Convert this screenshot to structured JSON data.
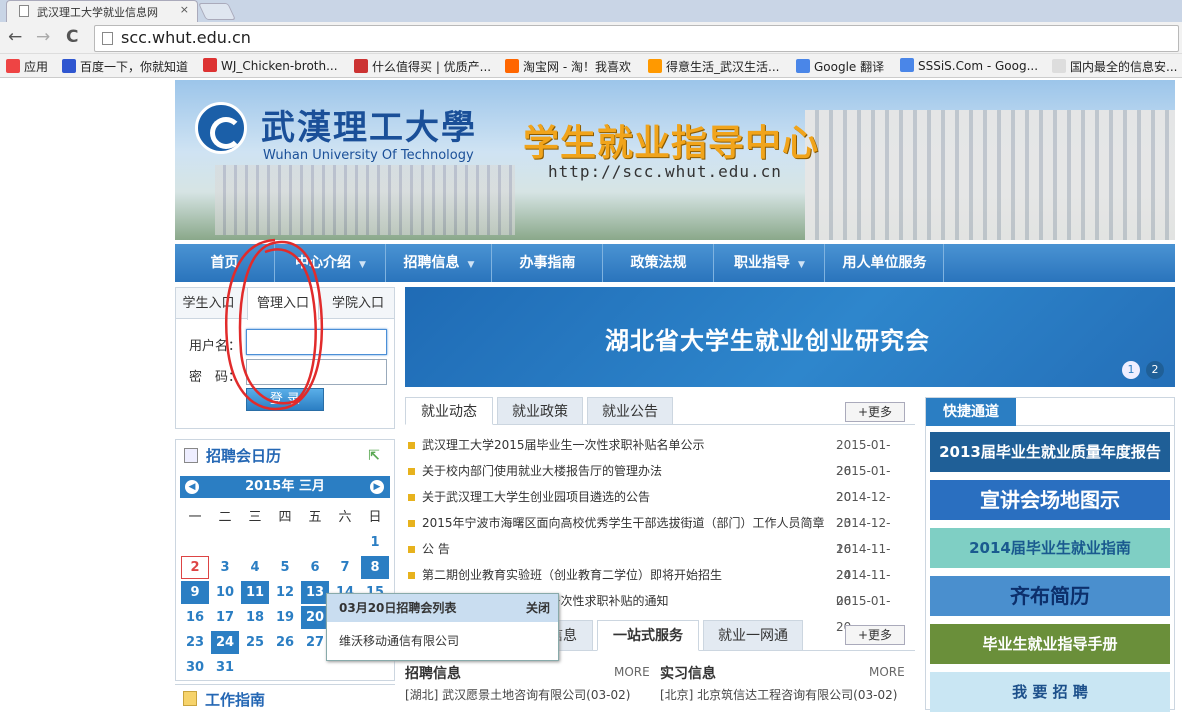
{
  "browser": {
    "tab_title": "武汉理工大学就业信息网",
    "tab_close": "×",
    "url": "scc.whut.edu.cn",
    "back": "←",
    "forward": "→",
    "reload": "C",
    "bookmarks": [
      {
        "label": "应用",
        "color": "#e44"
      },
      {
        "label": "百度一下，你就知道",
        "color": "#2f56d0"
      },
      {
        "label": "WJ_Chicken-broth...",
        "color": "#d33"
      },
      {
        "label": "什么值得买 | 优质产...",
        "color": "#c33"
      },
      {
        "label": "淘宝网 - 淘！我喜欢",
        "color": "#f60"
      },
      {
        "label": "得意生活_武汉生活...",
        "color": "#f90"
      },
      {
        "label": "Google 翻译",
        "color": "#4a86e8"
      },
      {
        "label": "SSSiS.Com - Goog...",
        "color": "#4a86e8"
      },
      {
        "label": "国内最全的信息安...",
        "color": "#ddd"
      }
    ]
  },
  "banner": {
    "uni_cn": "武漢理工大學",
    "uni_en": "Wuhan University Of Technology",
    "center_title": "学生就业指导中心",
    "center_url": "http://scc.whut.edu.cn"
  },
  "nav": [
    {
      "label": "首页",
      "arrow": ""
    },
    {
      "label": "中心介绍",
      "arrow": "▼"
    },
    {
      "label": "招聘信息",
      "arrow": "▼"
    },
    {
      "label": "办事指南",
      "arrow": ""
    },
    {
      "label": "政策法规",
      "arrow": ""
    },
    {
      "label": "职业指导",
      "arrow": "▼"
    },
    {
      "label": "用人单位服务",
      "arrow": ""
    }
  ],
  "login": {
    "tabs": [
      "学生入口",
      "管理入口",
      "学院入口"
    ],
    "username_label": "用户名：",
    "password_label": "密　码：",
    "submit": "登 录"
  },
  "calendar": {
    "title": "招聘会日历",
    "expand": "⇱",
    "month": "2015年 三月",
    "prev": "◀",
    "next": "▶",
    "weekdays": [
      "一",
      "二",
      "三",
      "四",
      "五",
      "六",
      "日"
    ],
    "weeks": [
      [
        "",
        "",
        "",
        "",
        "",
        "",
        "1"
      ],
      [
        "2",
        "3",
        "4",
        "5",
        "6",
        "7",
        "8"
      ],
      [
        "9",
        "10",
        "11",
        "12",
        "13",
        "14",
        "15"
      ],
      [
        "16",
        "17",
        "18",
        "19",
        "20",
        "21",
        "22"
      ],
      [
        "23",
        "24",
        "25",
        "26",
        "27",
        "28",
        "29"
      ],
      [
        "30",
        "31",
        "",
        "",
        "",
        "",
        ""
      ]
    ],
    "highlighted": [
      "8",
      "9",
      "11",
      "13",
      "20",
      "24"
    ],
    "today": "2"
  },
  "popup": {
    "title": "03月20日招聘会列表",
    "close": "关闭",
    "company": "维沃移动通信有限公司"
  },
  "slide": {
    "title": "湖北省大学生就业创业研究会",
    "pages": [
      "1",
      "2"
    ]
  },
  "news": {
    "tabs": [
      "就业动态",
      "就业政策",
      "就业公告"
    ],
    "more": "+更多",
    "items": [
      {
        "title": "武汉理工大学2015届毕业生一次性求职补贴名单公示",
        "date": "2015-01-26"
      },
      {
        "title": "关于校内部门使用就业大楼报告厅的管理办法",
        "date": "2015-01-20"
      },
      {
        "title": "关于武汉理工大学生创业园项目遴选的公告",
        "date": "2014-12-23"
      },
      {
        "title": "2015年宁波市海曙区面向高校优秀学生干部选拔街道（部门）工作人员简章",
        "date": "2014-12-16"
      },
      {
        "title": "公 告",
        "date": "2014-11-24"
      },
      {
        "title": "第二期创业教育实验班（创业教育二学位）即将开始招生",
        "date": "2014-11-06"
      },
      {
        "title": "关于申报2015届毕业生一次性求职补贴的通知",
        "date": "2015-01-20"
      }
    ]
  },
  "services": {
    "tabs": [
      "就业信息",
      "一站式服务",
      "就业一网通"
    ],
    "more": "+更多",
    "recruit_title": "招聘信息",
    "recruit_more": "MORE",
    "intern_title": "实习信息",
    "intern_more": "MORE",
    "recruit_item": "[湖北] 武汉愿景土地咨询有限公司(03-02)",
    "intern_item": "[北京] 北京筑信达工程咨询有限公司(03-02)"
  },
  "guide": {
    "title": "工作指南"
  },
  "quick": {
    "title": "快捷通道",
    "links": [
      {
        "label": "2013届毕业生就业质量年度报告",
        "bg": "#1f5f97",
        "color": "#ffffff"
      },
      {
        "label": "宣讲会场地图示",
        "bg": "#2a6fc0",
        "color": "#ffffff"
      },
      {
        "label": "2014届毕业生就业指南",
        "bg": "#7fcfc4",
        "color": "#1a5a8f"
      },
      {
        "label": "齐布简历",
        "bg": "#4a8fce",
        "color": "#0c2f6b"
      },
      {
        "label": "毕业生就业指导手册",
        "bg": "#6a8f3a",
        "color": "#ffffff"
      },
      {
        "label": "我 要 招 聘",
        "bg": "#c9e6f3",
        "color": "#1b4f8a"
      }
    ]
  }
}
